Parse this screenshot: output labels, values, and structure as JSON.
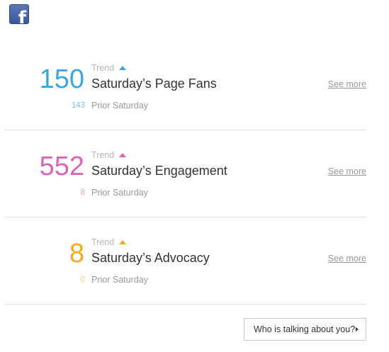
{
  "logo": {
    "icon": "facebook-f-icon",
    "glyph": "f"
  },
  "colors": {
    "fans": "#3aa8dd",
    "fans_prior": "#7cc4ea",
    "engagement": "#e062b8",
    "engagement_prior": "#e9a2d3",
    "advocacy": "#f5ab1c",
    "advocacy_prior": "#f7cd7a"
  },
  "metrics": [
    {
      "value": "150",
      "trend_label": "Trend",
      "trend_direction": "up",
      "title": "Saturday’s Page Fans",
      "prior_value": "143",
      "prior_label": "Prior Saturday",
      "see_more": "See more"
    },
    {
      "value": "552",
      "trend_label": "Trend",
      "trend_direction": "up",
      "title": "Saturday’s Engagement",
      "prior_value": "8",
      "prior_label": "Prior Saturday",
      "see_more": "See more"
    },
    {
      "value": "8",
      "trend_label": "Trend",
      "trend_direction": "up",
      "title": "Saturday’s Advocacy",
      "prior_value": "0",
      "prior_label": "Prior Saturday",
      "see_more": "See more"
    }
  ],
  "footer": {
    "button_label": "Who is talking about you?",
    "button_icon": "caret-right-icon"
  }
}
